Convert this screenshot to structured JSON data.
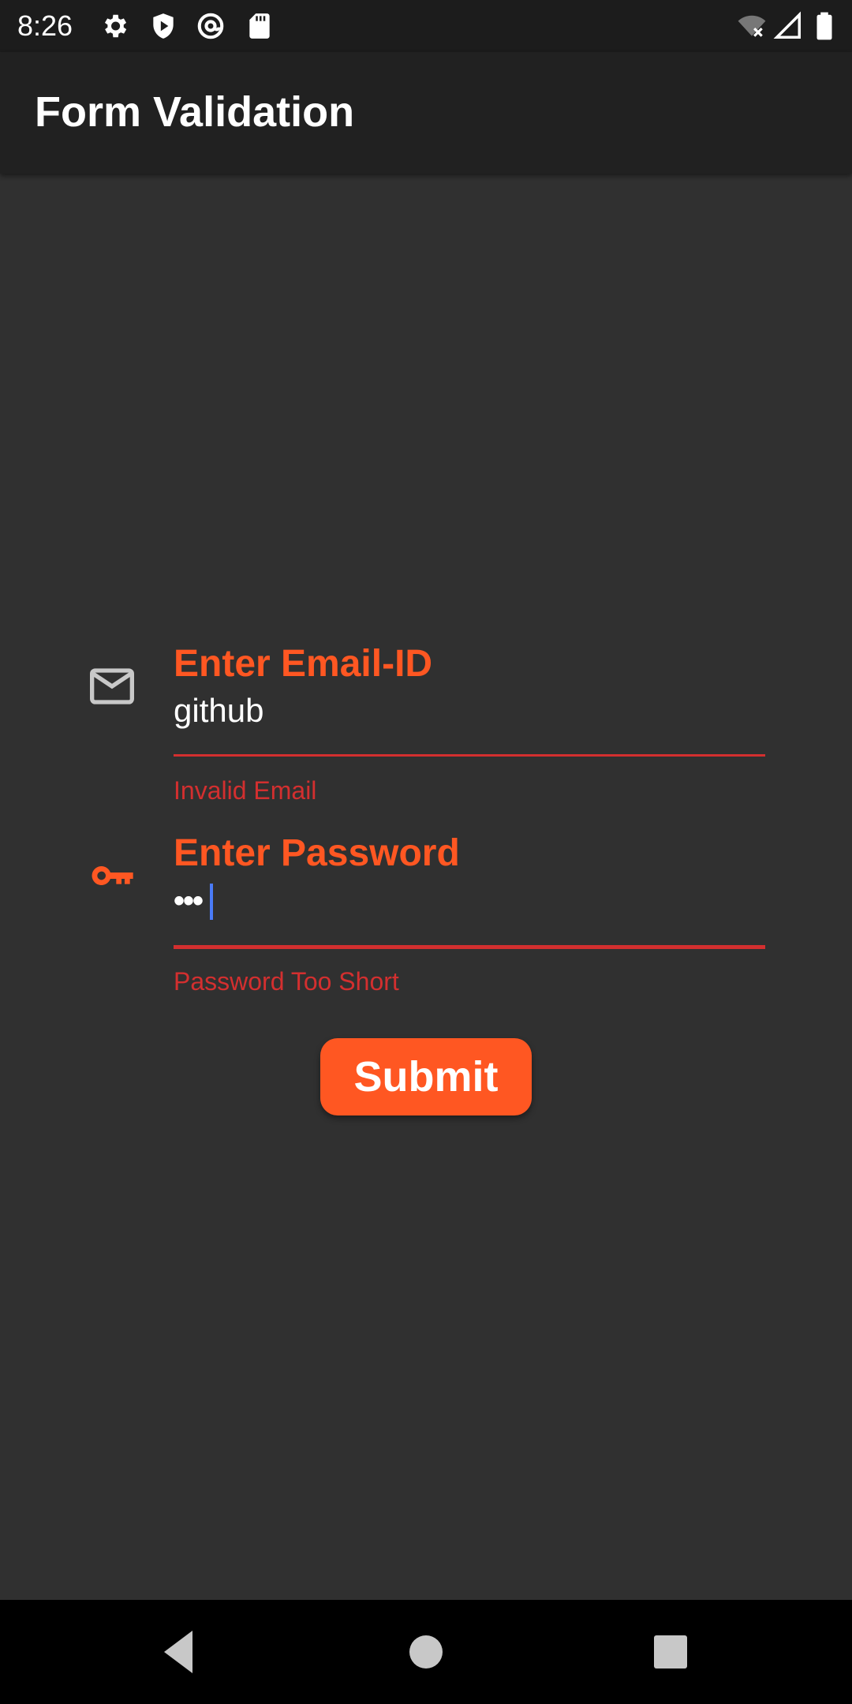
{
  "status_bar": {
    "time": "8:26",
    "icons": [
      "settings-icon",
      "shield-icon",
      "at-sign-icon",
      "sd-card-icon",
      "wifi-off-icon",
      "cell-signal-icon",
      "battery-icon"
    ]
  },
  "app_bar": {
    "title": "Form Validation"
  },
  "form": {
    "email": {
      "icon": "mail-icon",
      "label": "Enter Email-ID",
      "value": "github",
      "error": "Invalid Email"
    },
    "password": {
      "icon": "key-icon",
      "label": "Enter Password",
      "value": "•••",
      "error": "Password Too Short"
    },
    "submit_label": "Submit"
  },
  "nav_bar": {
    "icons": [
      "back-icon",
      "home-icon",
      "recents-icon"
    ]
  },
  "colors": {
    "accent": "#ff5722",
    "error": "#d32f2f",
    "background": "#303030",
    "app_bar": "#212121",
    "cursor": "#4a7bf7"
  }
}
